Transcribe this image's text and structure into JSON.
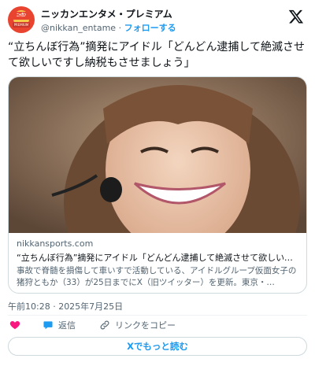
{
  "account": {
    "name": "ニッカンエンタメ・プレミアム",
    "handle": "@nikkan_entame",
    "separator": "·",
    "follow_label": "フォローする",
    "avatar_icon": "nikkan-premium-logo-icon"
  },
  "brand_icon": "x-logo-icon",
  "tweet": {
    "text": "“立ちんぼ行為”摘発にアイドル「どんどん逮捕して絶滅させて欲しいですし納税もさせましょう」"
  },
  "link_card": {
    "domain": "nikkansports.com",
    "title": "“立ちんぼ行為”摘発にアイドル「どんどん逮捕して絶滅させて欲しいで…",
    "description": "事故で脊髄を損傷して車いすで活動している、アイドルグループ仮面女子の猪狩ともか（33）が25日までにX（旧ツイッター）を更新。東京・…"
  },
  "timestamp": "午前10:28 · 2025年7月25日",
  "actions": {
    "like_icon": "heart-icon",
    "reply_label": "返信",
    "reply_icon": "reply-icon",
    "copy_link_label": "リンクをコピー",
    "copy_link_icon": "link-icon"
  },
  "more_button": {
    "label": "Xでもっと読む"
  },
  "colors": {
    "accent": "#1d9bf0",
    "like": "#f91880",
    "text": "#0f1419",
    "muted": "#536471",
    "border": "#cfd9de"
  }
}
